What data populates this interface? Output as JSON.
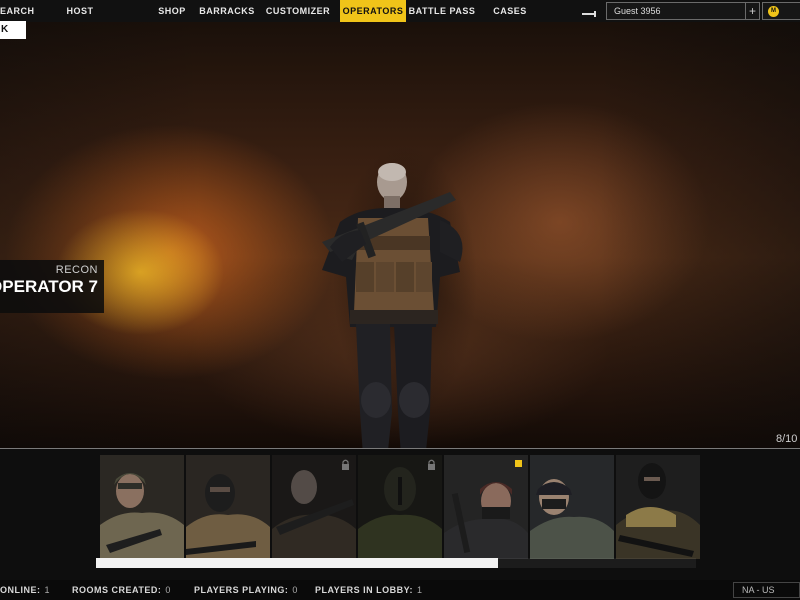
{
  "nav": {
    "items": [
      {
        "label": "EARCH",
        "active": false
      },
      {
        "label": "HOST",
        "active": false
      },
      {
        "label": "SHOP",
        "active": false
      },
      {
        "label": "BARRACKS",
        "active": false
      },
      {
        "label": "CUSTOMIZER",
        "active": false
      },
      {
        "label": "OPERATORS",
        "active": true
      },
      {
        "label": "BATTLE PASS",
        "active": false
      },
      {
        "label": "CASES",
        "active": false
      }
    ],
    "username": "Guest 3956",
    "plus_label": "+",
    "coin_symbol": "M",
    "accent_color": "#f0c419"
  },
  "back_label": "K",
  "operator": {
    "class": "RECON",
    "name": "OPERATOR 7",
    "counter": "8/10"
  },
  "carousel": {
    "cards": [
      {
        "id": 1,
        "locked": false,
        "new": false,
        "icon": "operator-portrait-helmet"
      },
      {
        "id": 2,
        "locked": false,
        "new": false,
        "icon": "operator-portrait-balaclava"
      },
      {
        "id": 3,
        "locked": true,
        "new": false,
        "icon": "operator-portrait-bald"
      },
      {
        "id": 4,
        "locked": true,
        "new": false,
        "icon": "operator-portrait-masked"
      },
      {
        "id": 5,
        "locked": false,
        "new": true,
        "icon": "operator-portrait-beanie"
      },
      {
        "id": 6,
        "locked": false,
        "new": false,
        "icon": "operator-portrait-cap"
      },
      {
        "id": 7,
        "locked": false,
        "new": false,
        "icon": "operator-portrait-hood"
      }
    ],
    "scroll_fraction": 0.67
  },
  "status": {
    "online_label": "ONLINE:",
    "online_value": "1",
    "rooms_label": "ROOMS CREATED:",
    "rooms_value": "0",
    "playing_label": "PLAYERS PLAYING:",
    "playing_value": "0",
    "lobby_label": "PLAYERS IN LOBBY:",
    "lobby_value": "1",
    "region": "NA - US"
  }
}
